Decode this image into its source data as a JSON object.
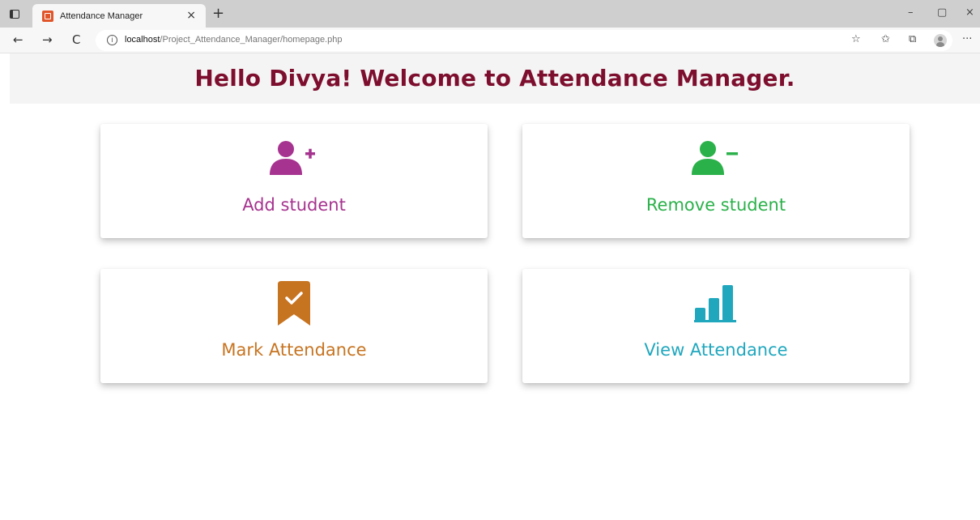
{
  "browser": {
    "tab_title": "Attendance Manager",
    "tab_close": "×",
    "new_tab": "+",
    "url_host": "localhost",
    "url_path": "/Project_Attendance_Manager/homepage.php",
    "info_glyph": "i",
    "nav": {
      "back": "←",
      "forward": "→",
      "reload": "C"
    },
    "window_controls": {
      "minimize": "–",
      "maximize": "▢",
      "close": "×"
    },
    "toolbar": {
      "favorite": "☆",
      "favorites": "✩",
      "collections": "⧉",
      "more": "···"
    }
  },
  "page": {
    "title": "Hello Divya! Welcome to Attendance Manager."
  },
  "cards": [
    {
      "label": "Add student",
      "icon": "add-user-icon",
      "color": "#a6338f"
    },
    {
      "label": "Remove student",
      "icon": "remove-user-icon",
      "color": "#2bb14a"
    },
    {
      "label": "Mark Attendance",
      "icon": "bookmark-check-icon",
      "color": "#c77421"
    },
    {
      "label": "View Attendance",
      "icon": "bar-chart-icon",
      "color": "#20a7be"
    }
  ]
}
